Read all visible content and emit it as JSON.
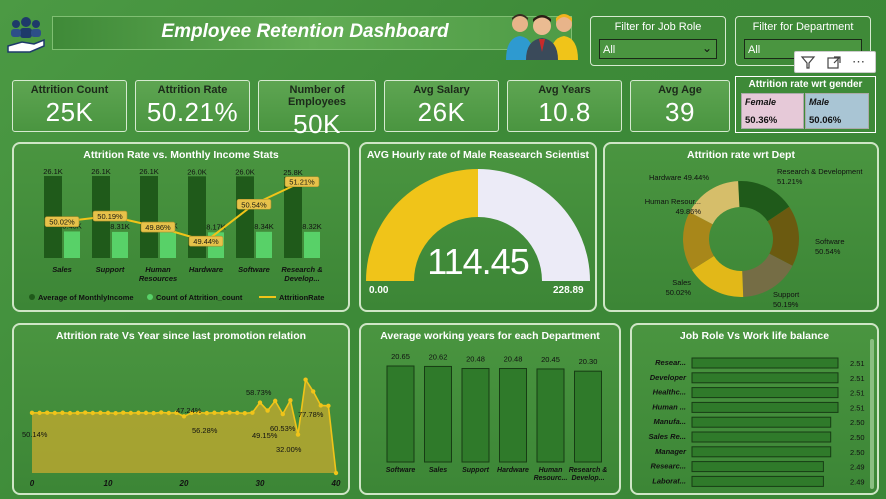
{
  "header": {
    "title": "Employee Retention Dashboard"
  },
  "filters": {
    "job_role": {
      "label": "Filter for Job Role",
      "value": "All"
    },
    "department": {
      "label": "Filter for Department",
      "value": "All"
    }
  },
  "kpis": [
    {
      "label": "Attrition Count",
      "value": "25K"
    },
    {
      "label": "Attrition Rate",
      "value": "50.21%"
    },
    {
      "label": "Number of Employees",
      "value": "50K"
    },
    {
      "label": "Avg Salary",
      "value": "26K"
    },
    {
      "label": "Avg Years",
      "value": "10.8"
    },
    {
      "label": "Avg Age",
      "value": "39"
    }
  ],
  "gender": {
    "title": "Attrition rate wrt gender",
    "female_label": "Female",
    "female_value": "50.36%",
    "male_label": "Male",
    "male_value": "50.06%"
  },
  "colors": {
    "dark_bar": "#1f5a1a",
    "light_bar": "#58d168",
    "gold": "#f0c419",
    "lavender": "#ecebf7"
  },
  "chart_data": [
    {
      "type": "bar",
      "title": "Attrition Rate vs. Monthly Income Stats",
      "categories": [
        "Sales",
        "Support",
        "Human Resources",
        "Hardware",
        "Software",
        "Research & Develop..."
      ],
      "category_lines": [
        [
          "Sales"
        ],
        [
          "Support"
        ],
        [
          "Human",
          "Resources"
        ],
        [
          "Hardware"
        ],
        [
          "Software"
        ],
        [
          "Research &",
          "Develop..."
        ]
      ],
      "series": [
        {
          "name": "Average of MonthlyIncome",
          "values": [
            26.1,
            26.1,
            26.1,
            26.0,
            26.0,
            25.8
          ],
          "labels": [
            "26.1K",
            "26.1K",
            "26.1K",
            "26.0K",
            "26.0K",
            "25.8K"
          ]
        },
        {
          "name": "Count of Attrition_count",
          "values": [
            8.45,
            8.31,
            8.42,
            8.17,
            8.34,
            8.32
          ],
          "labels": [
            "8.45K",
            "8.31K",
            "8.42K",
            "8.17K",
            "8.34K",
            "8.32K"
          ]
        },
        {
          "name": "AttritionRate",
          "values": [
            50.02,
            50.19,
            49.86,
            49.44,
            50.54,
            51.21
          ],
          "labels": [
            "50.02%",
            "50.19%",
            "49.86%",
            "49.44%",
            "50.54%",
            "51.21%"
          ]
        }
      ]
    },
    {
      "type": "gauge",
      "title": "AVG Hourly rate of Male Reasearch Scientist",
      "value": 114.45,
      "value_label": "114.45",
      "min": 0,
      "max": 228.89,
      "min_label": "0.00",
      "max_label": "228.89"
    },
    {
      "type": "pie",
      "title": "Attrition rate wrt Dept",
      "slices": [
        {
          "name": "Hardware",
          "value": 49.44,
          "label": "Hardware 49.44%",
          "color": "#1f5a1a"
        },
        {
          "name": "Research & Development",
          "value": 51.21,
          "label": "Research & Development 51.21%",
          "color": "#6b5a10"
        },
        {
          "name": "Software",
          "value": 50.54,
          "label": "Software 50.54%",
          "color": "#756d45"
        },
        {
          "name": "Support",
          "value": 50.19,
          "label": "Support 50.19%",
          "color": "#e2b818"
        },
        {
          "name": "Sales",
          "value": 50.02,
          "label": "Sales 50.02%",
          "color": "#a8871a"
        },
        {
          "name": "Human Resources",
          "value": 49.86,
          "label": "Human Resour... 49.86%",
          "color": "#d6be6a"
        }
      ]
    },
    {
      "type": "area",
      "title": "Attrition rate Vs Year since last promotion relation",
      "x": [
        0,
        1,
        2,
        3,
        4,
        5,
        6,
        7,
        8,
        9,
        10,
        11,
        12,
        13,
        14,
        15,
        16,
        17,
        18,
        19,
        20,
        21,
        22,
        23,
        24,
        25,
        26,
        27,
        28,
        29,
        30,
        31,
        32,
        33,
        34,
        35,
        36,
        37,
        38,
        39,
        40
      ],
      "y": [
        50.14,
        50.1,
        50.3,
        50.0,
        50.2,
        49.9,
        50.1,
        50.4,
        50.0,
        50.2,
        50.1,
        49.8,
        50.3,
        50.0,
        50.2,
        50.1,
        49.9,
        50.5,
        50.0,
        50.2,
        47.24,
        50.1,
        50.3,
        49.9,
        50.2,
        50.0,
        50.4,
        50.1,
        49.8,
        50.3,
        58.73,
        52.0,
        60.1,
        49.15,
        60.53,
        32.0,
        77.78,
        68.0,
        56.28,
        56.0,
        0
      ],
      "annotations": [
        "50.14%",
        "47.24%",
        "56.28%",
        "58.73%",
        "49.15%",
        "60.53%",
        "32.00%",
        "77.78%"
      ],
      "xticks": [
        "0",
        "10",
        "20",
        "30",
        "40"
      ],
      "xlim": [
        0,
        40
      ],
      "ylim": [
        0,
        100
      ]
    },
    {
      "type": "bar",
      "title": "Average working years for each Department",
      "categories": [
        "Software",
        "Sales",
        "Support",
        "Hardware",
        "Human Resourc...",
        "Research & Develop..."
      ],
      "category_lines": [
        [
          "Software"
        ],
        [
          "Sales"
        ],
        [
          "Support"
        ],
        [
          "Hardware"
        ],
        [
          "Human",
          "Resourc..."
        ],
        [
          "Research &",
          "Develop..."
        ]
      ],
      "values": [
        20.65,
        20.62,
        20.48,
        20.48,
        20.45,
        20.3
      ],
      "labels": [
        "20.65",
        "20.62",
        "20.48",
        "20.48",
        "20.45",
        "20.30"
      ]
    },
    {
      "type": "bar",
      "title": "Job Role Vs Work life balance",
      "categories": [
        "Resear...",
        "Developer",
        "Healthc...",
        "Human ...",
        "Manufa...",
        "Sales Re...",
        "Manager",
        "Researc...",
        "Laborat..."
      ],
      "values": [
        2.51,
        2.51,
        2.51,
        2.51,
        2.5,
        2.5,
        2.5,
        2.49,
        2.49
      ],
      "labels": [
        "2.51",
        "2.51",
        "2.51",
        "2.51",
        "2.50",
        "2.50",
        "2.50",
        "2.49",
        "2.49"
      ]
    }
  ]
}
